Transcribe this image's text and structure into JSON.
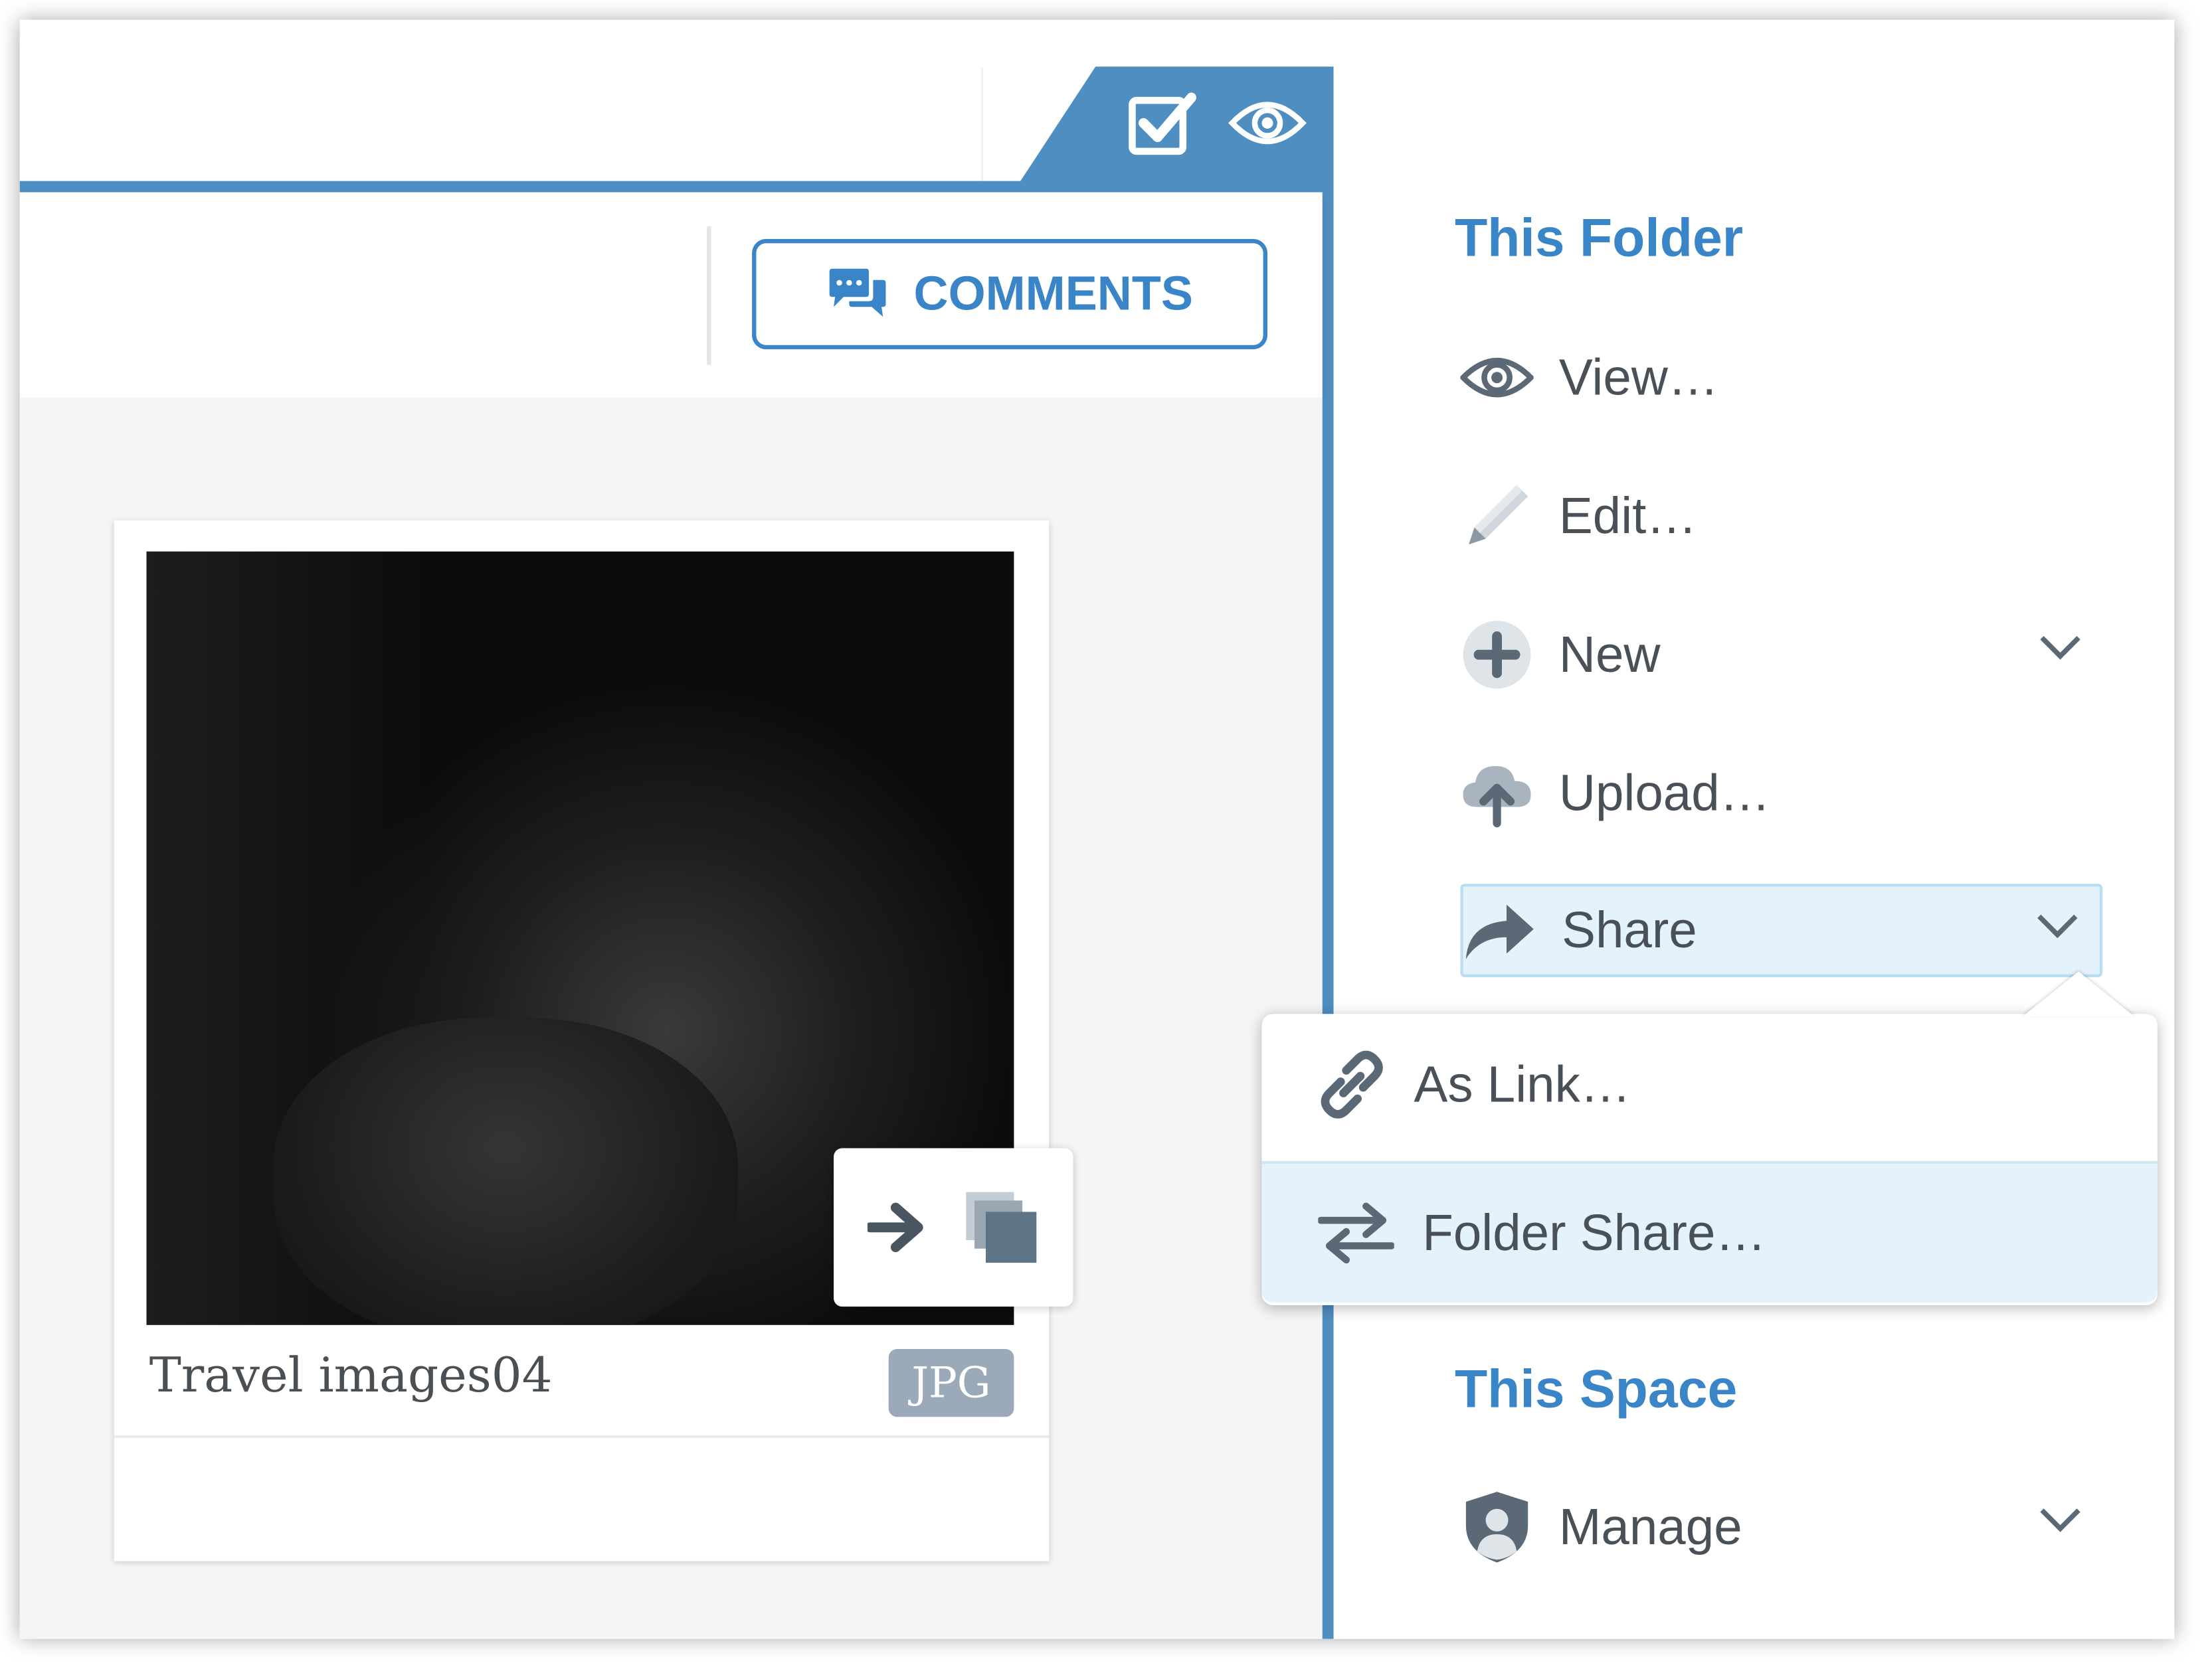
{
  "header": {
    "comments_label": "COMMENTS",
    "top_icons": [
      "checkbox-icon",
      "eye-icon"
    ]
  },
  "file_card": {
    "name": "Travel images04",
    "type_badge": "JPG",
    "actions": [
      "arrow-right-icon",
      "copy-icon"
    ]
  },
  "sidebar": {
    "this_folder": {
      "title": "This Folder",
      "items": [
        {
          "label": "View…",
          "icon": "eye-icon"
        },
        {
          "label": "Edit…",
          "icon": "pencil-icon"
        },
        {
          "label": "New",
          "icon": "plus-circle-icon"
        },
        {
          "label": "Upload…",
          "icon": "cloud-upload-icon"
        },
        {
          "label": "Share",
          "icon": "share-arrow-icon"
        }
      ]
    },
    "share_menu": [
      {
        "label": "As Link…",
        "icon": "link-icon"
      },
      {
        "label": "Folder Share…",
        "icon": "swap-arrows-icon"
      }
    ],
    "this_space": {
      "title": "This Space",
      "items": [
        {
          "label": "Manage",
          "icon": "shield-user-icon"
        }
      ]
    }
  },
  "colors": {
    "accent": "#3a85c7",
    "frame_blue": "#4f8ec1",
    "highlight": "#e3f2fb",
    "badge_gray": "#9baab8"
  }
}
